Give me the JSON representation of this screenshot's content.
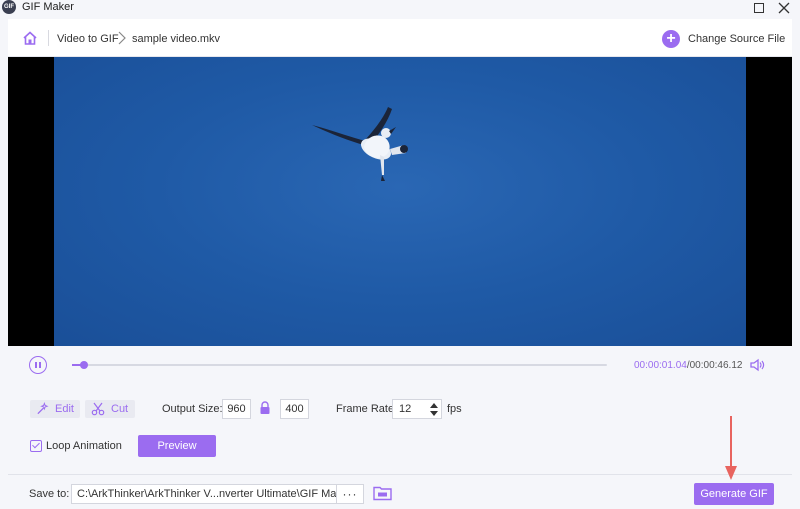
{
  "window": {
    "app_icon_text": "GIF",
    "title": "GIF Maker"
  },
  "nav": {
    "breadcrumb_1": "Video to GIF",
    "breadcrumb_2": "sample video.mkv",
    "change_source_label": "Change Source File"
  },
  "playback": {
    "current_time": "00:00:01.04",
    "separator": "/",
    "total_time": "00:00:46.12",
    "progress_fraction": 0.0225
  },
  "controls": {
    "edit_label": "Edit",
    "cut_label": "Cut",
    "output_size_label": "Output Size:",
    "width": "960",
    "height": "400",
    "frame_rate_label": "Frame Rate:",
    "frame_rate": "12",
    "fps_unit": "fps",
    "loop_label": "Loop Animation",
    "loop_checked": true,
    "preview_label": "Preview"
  },
  "footer": {
    "save_to_label": "Save to:",
    "save_path": "C:\\ArkThinker\\ArkThinker V...nverter Ultimate\\GIF Maker",
    "more_label": "···",
    "generate_label": "Generate GIF"
  },
  "colors": {
    "accent": "#9b6cf0",
    "video_bg": "#1f5aa6",
    "annotation": "#e8645f"
  }
}
